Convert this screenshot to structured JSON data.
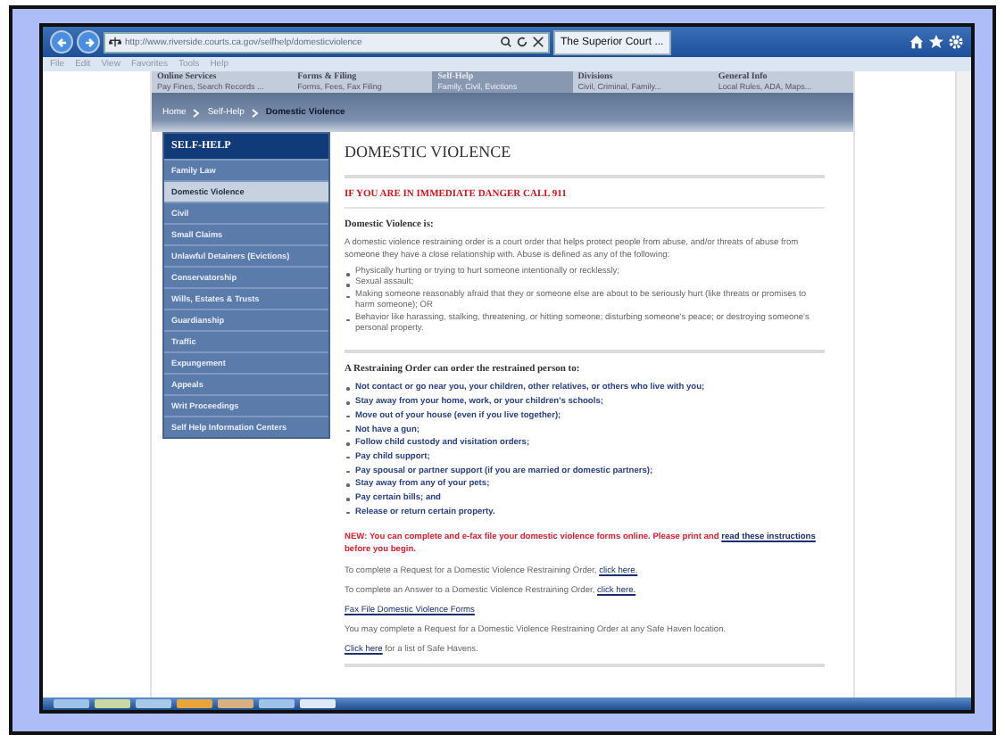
{
  "browser": {
    "address": "http://www.riverside.courts.ca.gov/selfhelp/domesticviolence",
    "tabs": [
      {
        "label": "The Superior Court ...",
        "selected": true
      }
    ],
    "menu": [
      "File",
      "Edit",
      "View",
      "Favorites",
      "Tools",
      "Help"
    ]
  },
  "top_nav": [
    {
      "title": "Online Services",
      "subtitle": "Pay Fines, Search Records ...",
      "selected": false
    },
    {
      "title": "Forms & Filing",
      "subtitle": "Forms, Fees, Fax Filing",
      "selected": false
    },
    {
      "title": "Self-Help",
      "subtitle": "Family, Civil, Evictions",
      "selected": true
    },
    {
      "title": "Divisions",
      "subtitle": "Civil, Criminal, Family...",
      "selected": false
    },
    {
      "title": "General Info",
      "subtitle": "Local Rules, ADA, Maps...",
      "selected": false
    }
  ],
  "breadcrumb": [
    "Home",
    "Self-Help",
    "Domestic Violence"
  ],
  "sidebar": {
    "title": "SELF-HELP",
    "items": [
      {
        "label": "Family Law",
        "selected": false
      },
      {
        "label": "Domestic Violence",
        "selected": true
      },
      {
        "label": "Civil",
        "selected": false
      },
      {
        "label": "Small Claims",
        "selected": false
      },
      {
        "label": "Unlawful Detainers (Evictions)",
        "selected": false
      },
      {
        "label": "Conservatorship",
        "selected": false
      },
      {
        "label": "Wills, Estates & Trusts",
        "selected": false
      },
      {
        "label": "Guardianship",
        "selected": false
      },
      {
        "label": "Traffic",
        "selected": false
      },
      {
        "label": "Expungement",
        "selected": false
      },
      {
        "label": "Appeals",
        "selected": false
      },
      {
        "label": "Writ Proceedings",
        "selected": false
      },
      {
        "label": "Self Help Information Centers",
        "selected": false
      }
    ]
  },
  "main": {
    "title": "DOMESTIC VIOLENCE",
    "alert": "IF YOU ARE IN IMMEDIATE DANGER CALL 911",
    "definition_heading": "Domestic Violence is:",
    "definition": "A domestic violence restraining order is a court order that helps protect people from abuse, and/or threats of abuse from someone they have a close relationship with. Abuse is defined as any of the following:",
    "abuse_list": [
      "Physically hurting or trying to hurt someone intentionally or recklessly;",
      "Sexual assault;",
      "Making someone reasonably afraid that they or someone else are about to be seriously hurt (like threats or promises to harm someone); OR",
      "Behavior like harassing, stalking, threatening, or hitting someone; disturbing someone's peace; or destroying someone's personal property."
    ],
    "orders_heading": "A Restraining Order can order the restrained person to:",
    "orders_list": [
      "Not contact or go near you, your children, other relatives, or others who live with you;",
      "Stay away from your home, work, or your children's schools;",
      "Move out of your house (even if you live together);",
      "Not have a gun;",
      "Follow child custody and visitation orders;",
      "Pay child support;",
      "Pay spousal or partner support (if you are married or domestic partners);",
      "Stay away from any of your pets;",
      "Pay certain bills; and",
      "Release or return certain property."
    ],
    "notice": {
      "before": "NEW: You can complete and e-fax file your domestic violence forms online. Please print and ",
      "link": "read these instructions",
      "after": " before you begin."
    },
    "lines": [
      {
        "before": "To complete a Request for a Domestic Violence Restraining Order, ",
        "link": "click here."
      },
      {
        "before": "To complete an Answer to a Domestic Violence Restraining Order, ",
        "link": "click here."
      },
      {
        "link": "Fax File Domestic Violence Forms"
      },
      {
        "before": "You may complete a Request for a Domestic Violence Restraining Order at any Safe Haven location."
      },
      {
        "link": "Click here",
        "after": " for a list of Safe Havens."
      }
    ]
  }
}
